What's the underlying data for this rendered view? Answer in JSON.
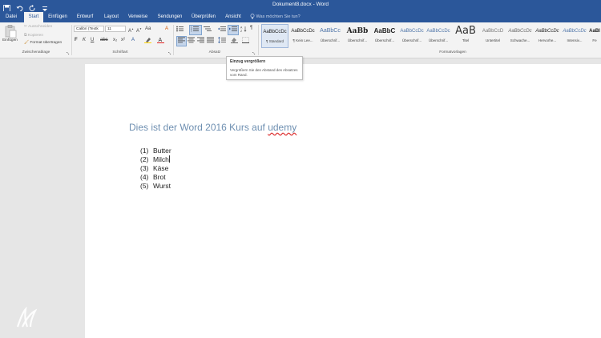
{
  "window": {
    "title": "Dokument8.docx - Word"
  },
  "tabs": [
    {
      "label": "Datei",
      "active": false
    },
    {
      "label": "Start",
      "active": true
    },
    {
      "label": "Einfügen",
      "active": false
    },
    {
      "label": "Entwurf",
      "active": false
    },
    {
      "label": "Layout",
      "active": false
    },
    {
      "label": "Verweise",
      "active": false
    },
    {
      "label": "Sendungen",
      "active": false
    },
    {
      "label": "Überprüfen",
      "active": false
    },
    {
      "label": "Ansicht",
      "active": false
    }
  ],
  "tell_me": "Was möchten Sie tun?",
  "clipboard": {
    "paste_label": "Einfügen",
    "cut_label": "Ausschneiden",
    "copy_label": "Kopieren",
    "format_painter_label": "Format übertragen",
    "group_label": "Zwischenablage"
  },
  "font": {
    "family": "Calibri (Textk",
    "size": "11",
    "group_label": "Schriftart"
  },
  "paragraph": {
    "group_label": "Absatz"
  },
  "styles": {
    "group_label": "Formatvorlagen",
    "items": [
      {
        "preview": "AaBbCcDc",
        "name": "¶ Standard"
      },
      {
        "preview": "AaBbCcDc",
        "name": "¶ Kein Lee..."
      },
      {
        "preview": "AaBbCc",
        "name": "Überschrif..."
      },
      {
        "preview": "AaBb",
        "name": "Überschrif..."
      },
      {
        "preview": "AaBbC",
        "name": "Überschrif..."
      },
      {
        "preview": "AaBbCcDc",
        "name": "Überschrif..."
      },
      {
        "preview": "AaBbCcDc",
        "name": "Überschrif..."
      },
      {
        "preview": "AaB",
        "name": "Titel"
      },
      {
        "preview": "AaBbCcD",
        "name": "Untertitel"
      },
      {
        "preview": "AaBbCcDc",
        "name": "Schwache..."
      },
      {
        "preview": "AaBbCcDc",
        "name": "Hervorhe..."
      },
      {
        "preview": "AaBbCcDc",
        "name": "Intensiv..."
      },
      {
        "preview": "AaBl",
        "name": "Fe"
      }
    ]
  },
  "tooltip": {
    "title": "Einzug vergrößern",
    "body": "Vergrößern Sie den Abstand des Absatzes vom Rand."
  },
  "document": {
    "title_text": "Dies ist der Word 2016 Kurs auf ",
    "title_misspelled": "udemy",
    "list": [
      {
        "num": "(1)",
        "text": "Butter"
      },
      {
        "num": "(2)",
        "text": "Milch"
      },
      {
        "num": "(3)",
        "text": "Käse"
      },
      {
        "num": "(4)",
        "text": "Brot"
      },
      {
        "num": "(5)",
        "text": "Wurst"
      }
    ]
  },
  "colors": {
    "word_blue": "#2b579a",
    "ribbon_bg": "#f3f3f3",
    "heading_blue": "#6e8fb1"
  }
}
